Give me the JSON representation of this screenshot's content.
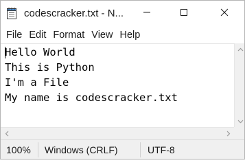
{
  "window": {
    "title": "codescracker.txt - N...",
    "app_icon": "notepad-icon",
    "controls": [
      "minimize-icon",
      "maximize-icon",
      "close-icon"
    ]
  },
  "menu": {
    "items": [
      "File",
      "Edit",
      "Format",
      "View",
      "Help"
    ]
  },
  "editor": {
    "lines": [
      "Hello World",
      "This is Python",
      "I'm a File",
      "My name is codescracker.txt"
    ]
  },
  "status": {
    "zoom": "100%",
    "line_ending": "Windows (CRLF)",
    "encoding": "UTF-8"
  }
}
